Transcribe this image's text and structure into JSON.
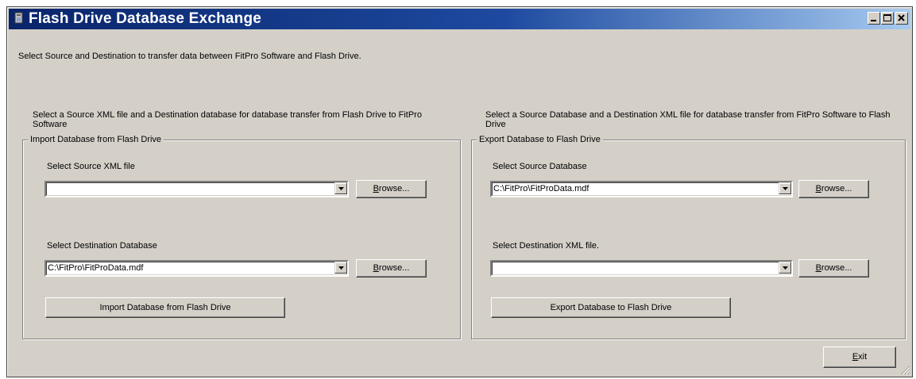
{
  "window": {
    "title": "Flash Drive Database Exchange",
    "intro": "Select Source and Destination to transfer data between FitPro Software and Flash Drive."
  },
  "import": {
    "description": "Select a Source XML file and a Destination database for database transfer from Flash Drive to FitPro Software",
    "group_title": "Import Database from Flash Drive",
    "source_label": "Select Source XML file",
    "source_value": "",
    "dest_label": "Select Destination Database",
    "dest_value": "C:\\FitPro\\FitProData.mdf",
    "browse_first": "B",
    "browse_rest": "rowse...",
    "action_label": "Import Database from Flash Drive"
  },
  "export": {
    "description": "Select a Source Database and a Destination XML file for database transfer from FitPro Software to Flash Drive",
    "group_title": "Export Database to Flash Drive",
    "source_label": "Select Source Database",
    "source_value": "C:\\FitPro\\FitProData.mdf",
    "dest_label": "Select Destination XML file.",
    "dest_value": "",
    "browse_first": "B",
    "browse_rest": "rowse...",
    "action_label": "Export  Database to Flash Drive"
  },
  "footer": {
    "exit_first": "E",
    "exit_rest": "xit"
  },
  "icons": {
    "app": "app-icon",
    "minimize": "minimize-icon",
    "maximize": "maximize-icon",
    "close": "close-icon",
    "dropdown": "chevron-down-icon",
    "resize": "resize-grip-icon"
  },
  "colors": {
    "titlebar_start": "#0a246a",
    "titlebar_end": "#a6caf0",
    "face": "#d4d0c8"
  }
}
